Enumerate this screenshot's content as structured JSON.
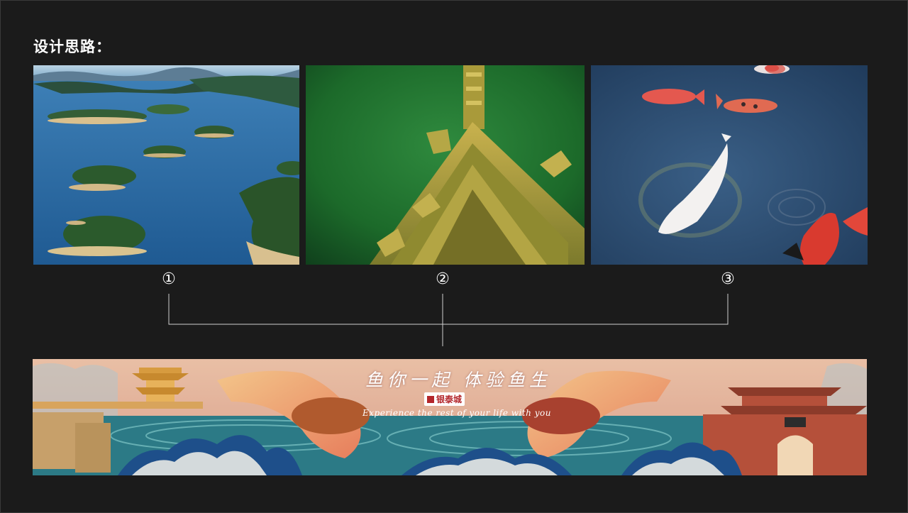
{
  "heading": "设计思路：",
  "steps": [
    "①",
    "②",
    "③"
  ],
  "photos": {
    "lake_islands": "aerial-lake-islands-photo",
    "underwater_ruins": "underwater-ancient-architecture-photo",
    "koi_pond": "koi-fish-pond-photo"
  },
  "banner": {
    "headline": "鱼你一起 体验鱼生",
    "brand": "银泰城",
    "slogan": "Experience the rest of your life with you"
  },
  "colors": {
    "background": "#1b1b1b",
    "lake_blue": "#2f6fae",
    "underwater_green": "#1f6b2e",
    "pond_blue": "#2a4a6e",
    "banner_peach": "#e7b39c",
    "banner_teal": "#2c7a86"
  }
}
